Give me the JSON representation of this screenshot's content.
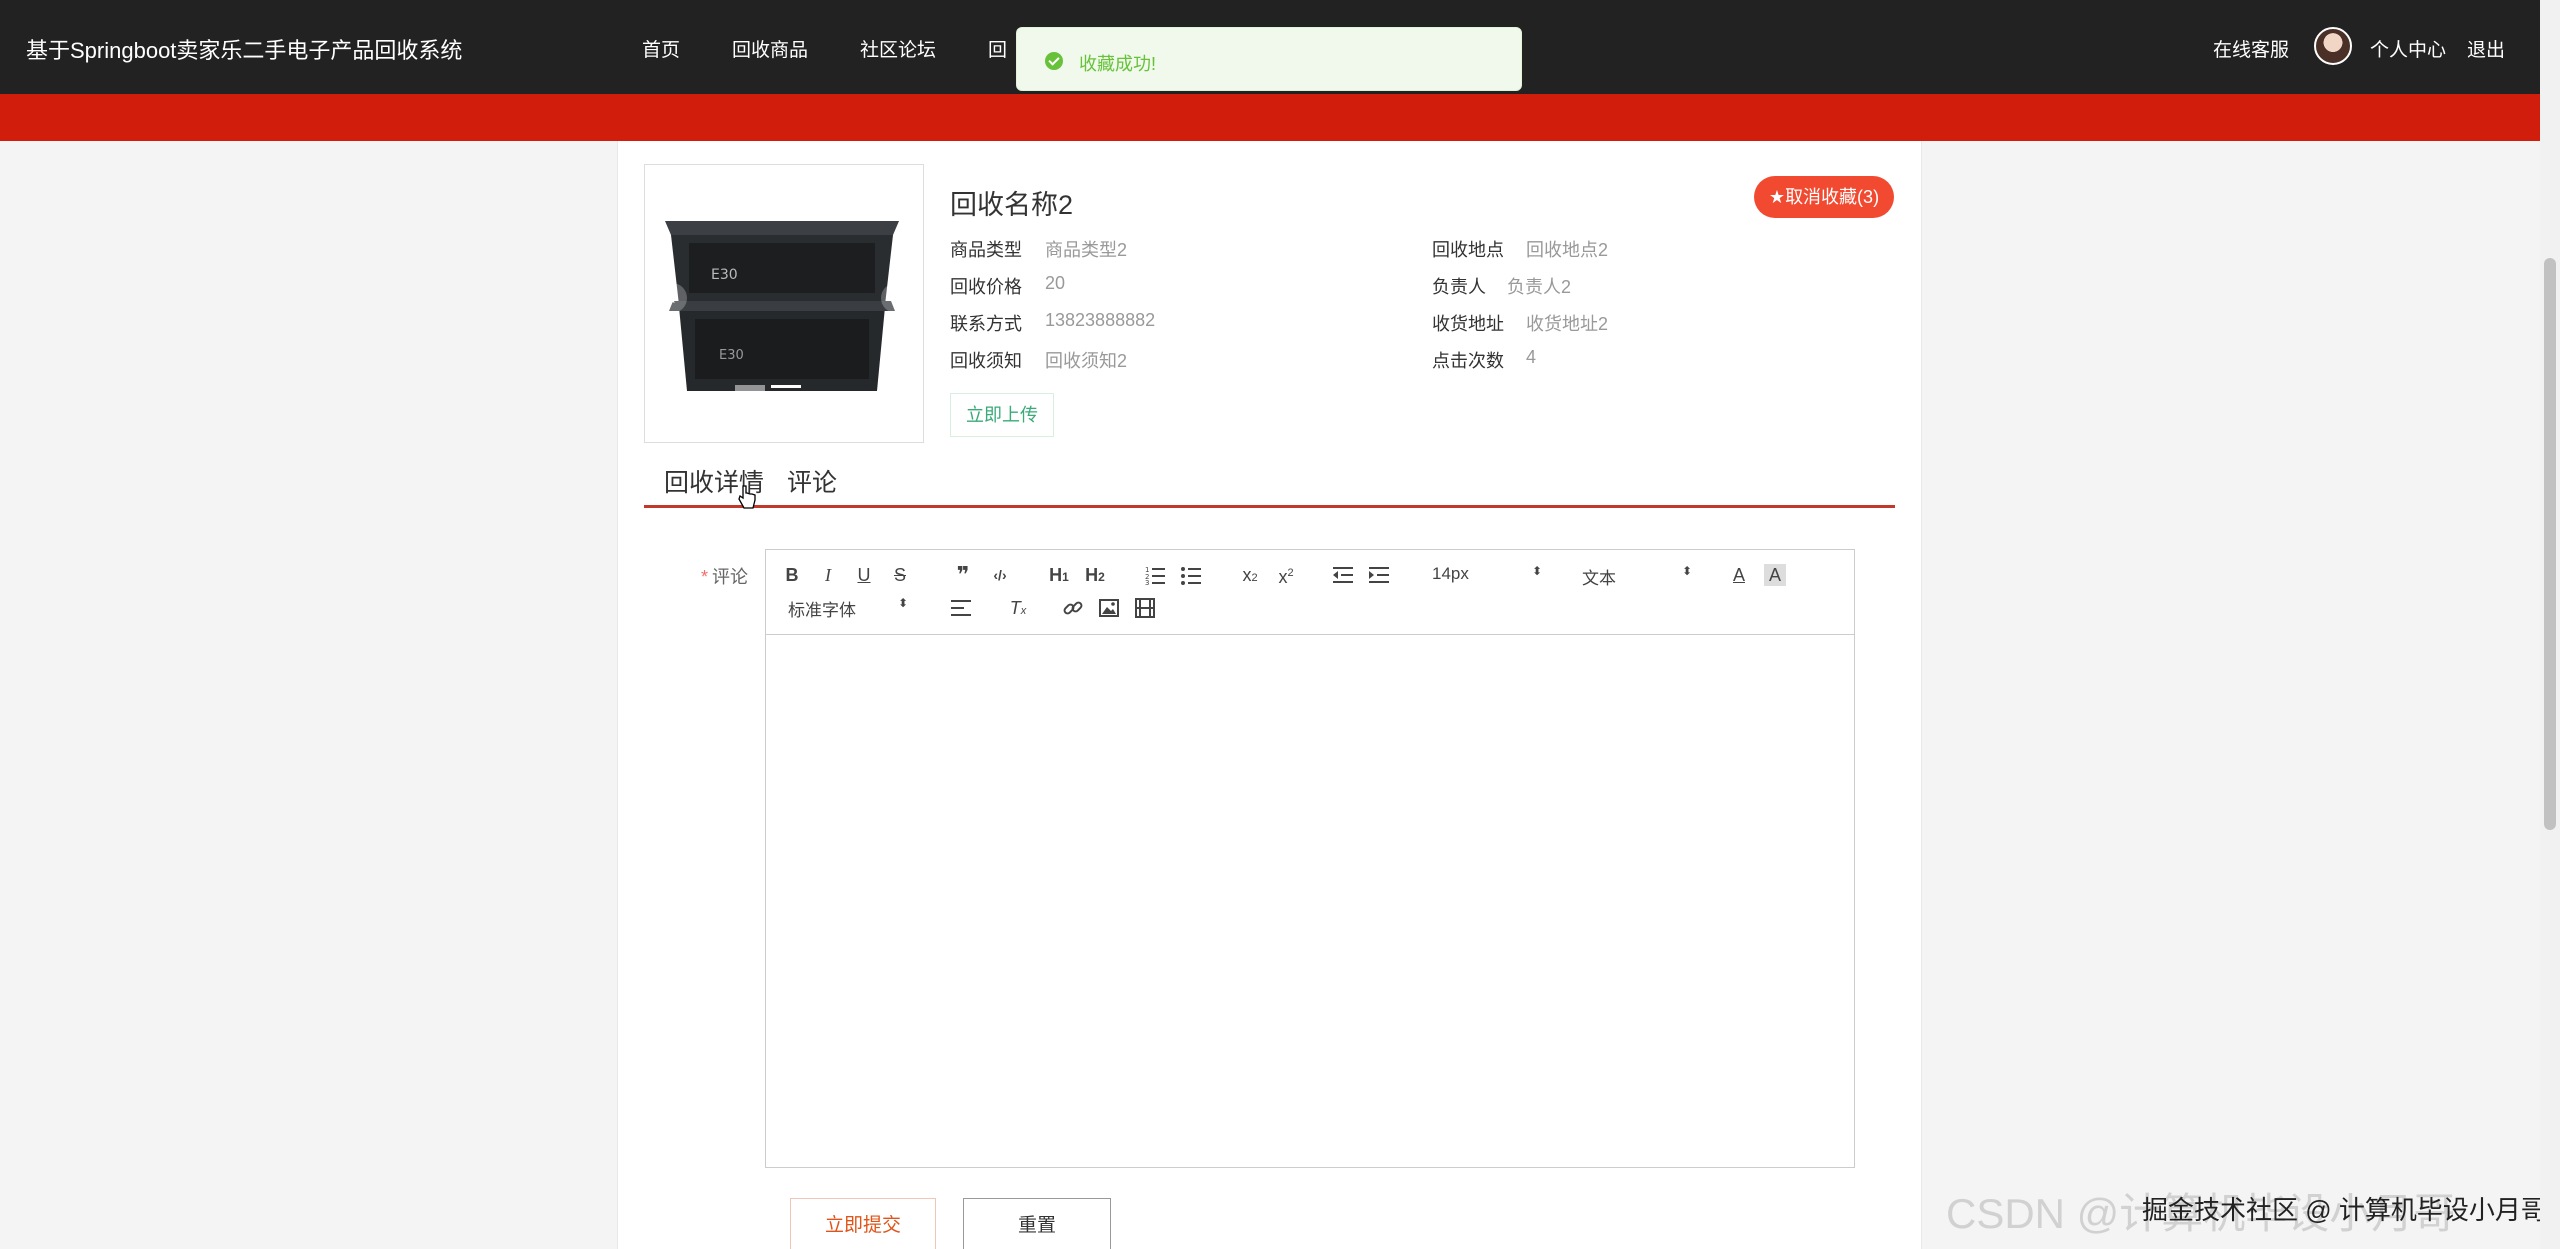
{
  "header": {
    "brand": "基于Springboot卖家乐二手电子产品回收系统",
    "nav": [
      "首页",
      "回收商品",
      "社区论坛",
      "回"
    ],
    "right": {
      "service": "在线客服",
      "personal": "个人中心",
      "logout": "退出"
    }
  },
  "toast": {
    "text": "收藏成功!",
    "type": "success"
  },
  "product": {
    "title": "回收名称2",
    "favorite_label": "取消收藏(3)",
    "left_fields": [
      {
        "label": "商品类型",
        "value": "商品类型2"
      },
      {
        "label": "回收价格",
        "value": "20"
      },
      {
        "label": "联系方式",
        "value": "13823888882"
      },
      {
        "label": "回收须知",
        "value": "回收须知2"
      }
    ],
    "right_fields": [
      {
        "label": "回收地点",
        "value": "回收地点2"
      },
      {
        "label": "负责人",
        "value": "负责人2"
      },
      {
        "label": "收货地址",
        "value": "收货地址2"
      },
      {
        "label": "点击次数",
        "value": "4"
      }
    ],
    "upload_label": "立即上传",
    "carousel": {
      "prev": "‹",
      "next": "›",
      "slides": 3,
      "active": 1
    }
  },
  "tabs": [
    "回收详情",
    "评论"
  ],
  "form": {
    "field_label": "评论",
    "required_mark": "*",
    "toolbar": {
      "font_size": "14px",
      "text_style": "文本",
      "font_family": "标准字体"
    },
    "submit_label": "立即提交",
    "reset_label": "重置"
  },
  "watermark": {
    "text": "CSDN @计算机毕设小月哥",
    "overlay": "掘金技术社区 @ 计算机毕设小月哥"
  },
  "colors": {
    "topbar": "#222222",
    "redbar": "#d11e0c",
    "accent": "#f24a31",
    "success": "#67c23a"
  }
}
